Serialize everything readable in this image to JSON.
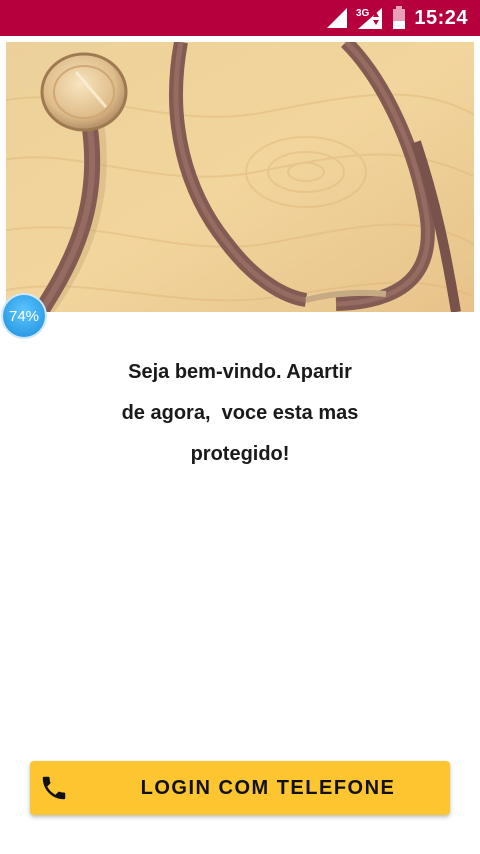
{
  "status_bar": {
    "time": "15:24",
    "network_label": "3G",
    "icons": [
      "signal-icon",
      "network-3g-icon",
      "battery-icon"
    ],
    "background": "#b5003d"
  },
  "hero": {
    "image": "stethoscope-photo"
  },
  "progress": {
    "value": 74,
    "label": "74%"
  },
  "welcome": {
    "line1": "Seja bem-vindo. Apartir",
    "line2": "de agora,  voce esta mas",
    "line3": "protegido!"
  },
  "login_button": {
    "label": "LOGIN COM TELEFONE",
    "icon": "phone-icon",
    "background": "#fdc530"
  }
}
